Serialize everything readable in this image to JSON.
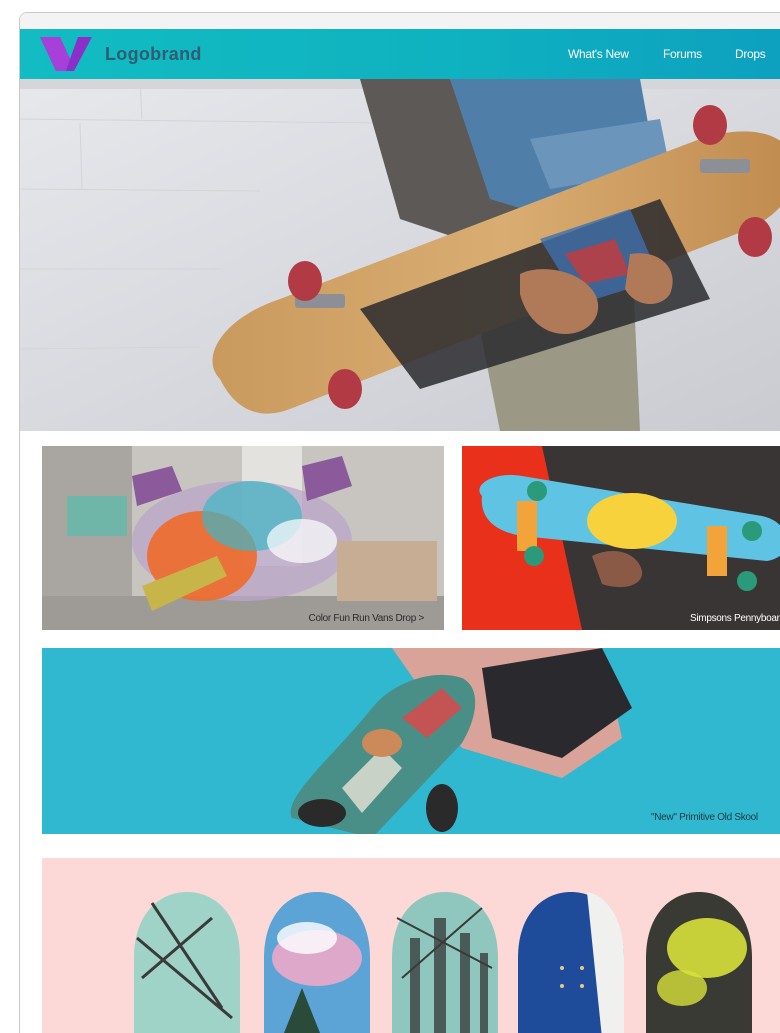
{
  "header": {
    "brand_name": "Logobrand",
    "nav": [
      "What's New",
      "Forums",
      "Drops"
    ]
  },
  "tiles": {
    "color_fun_caption": "Color Fun Run Vans Drop",
    "color_fun_arrow": ">",
    "simpsons_caption": "Simpsons Pennyboard",
    "primitive_caption": "\"New\" Primitive Old Skool"
  },
  "colors": {
    "nav_gradient_start": "#12bcc2",
    "nav_gradient_end": "#0d9fbf",
    "brand_text": "#2f5d72",
    "logo_purple": "#8b2fc9",
    "panel_pink": "#fcd9d6",
    "sky_blue": "#2fb8cf",
    "red_backdrop": "#e8301b"
  },
  "icons": [
    "logo-v-mark-icon"
  ]
}
